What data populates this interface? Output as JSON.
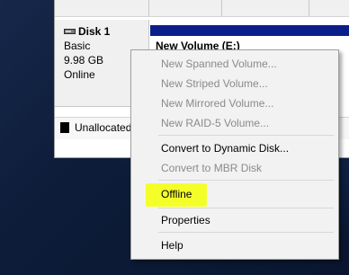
{
  "disk": {
    "name": "Disk 1",
    "type": "Basic",
    "size": "9.98 GB",
    "status": "Online"
  },
  "volume": {
    "label": "New Volume  (E:)"
  },
  "legend": {
    "unallocated": "Unallocated"
  },
  "context_menu": {
    "items": [
      {
        "label": "New Spanned Volume...",
        "enabled": false
      },
      {
        "label": "New Striped Volume...",
        "enabled": false
      },
      {
        "label": "New Mirrored Volume...",
        "enabled": false
      },
      {
        "label": "New RAID-5 Volume...",
        "enabled": false
      },
      {
        "label": "Convert to Dynamic Disk...",
        "enabled": true
      },
      {
        "label": "Convert to MBR Disk",
        "enabled": false
      },
      {
        "label": "Offline",
        "enabled": true,
        "highlighted": true
      },
      {
        "label": "Properties",
        "enabled": true
      },
      {
        "label": "Help",
        "enabled": true
      }
    ]
  },
  "colors": {
    "highlight": "#f4ff29",
    "volume_header": "#0b1f8a",
    "desktop": "#0d1c38"
  },
  "icons": {
    "disk": "disk-drive-icon"
  }
}
